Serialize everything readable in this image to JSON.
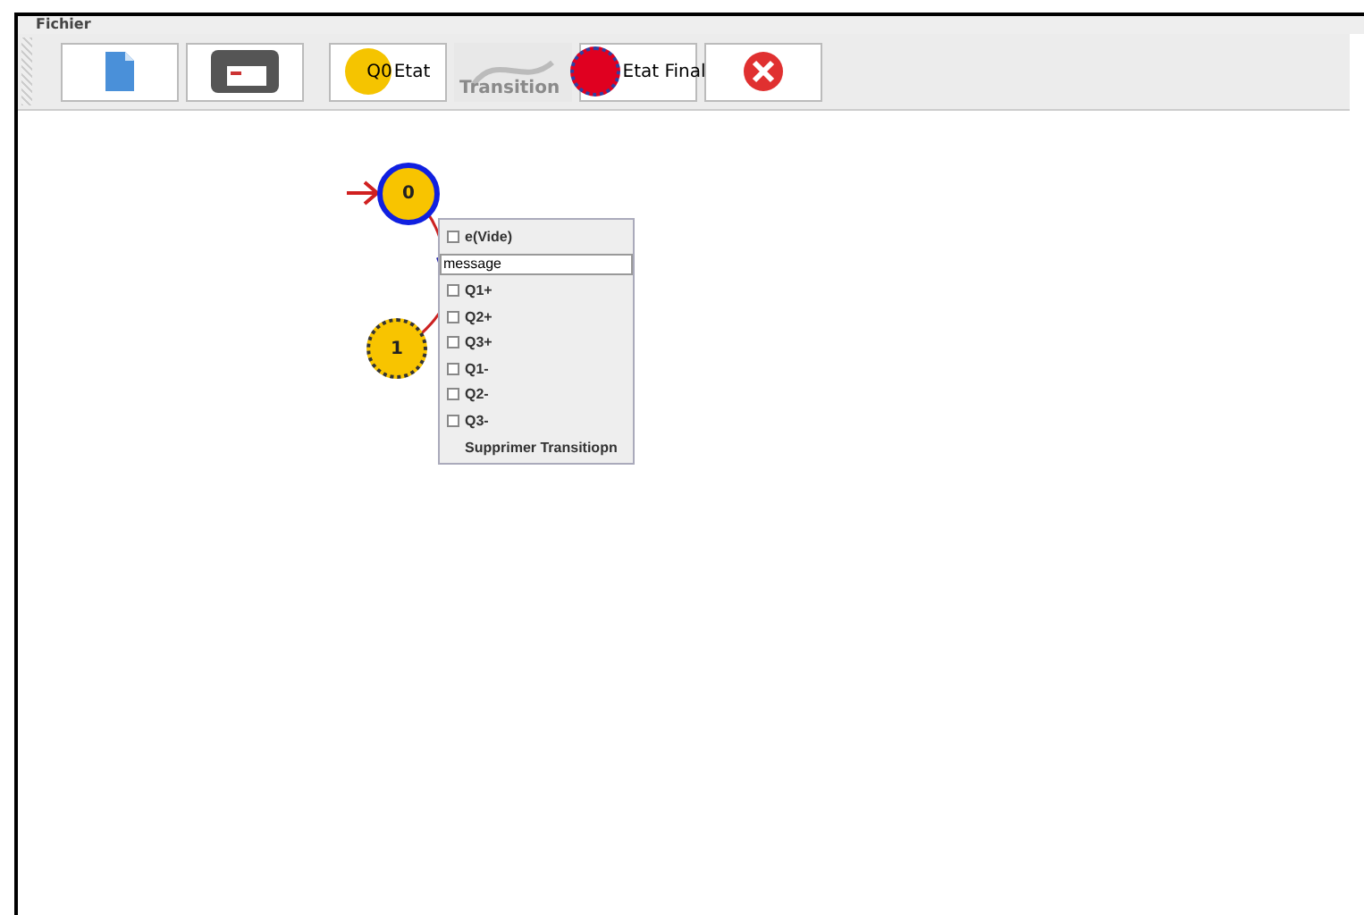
{
  "menu_bar": {
    "items": [
      "Fichier"
    ]
  },
  "toolbar": {
    "buttons": [
      {
        "kind": "new",
        "disabled": false
      },
      {
        "kind": "save",
        "disabled": false
      },
      {
        "kind": "state",
        "disabled": false,
        "badge": "Q0",
        "label": "Etat"
      },
      {
        "kind": "transition",
        "disabled": true,
        "label": "Transition"
      },
      {
        "kind": "final",
        "disabled": false,
        "label": "Etat Final"
      },
      {
        "kind": "delete",
        "disabled": false
      }
    ]
  },
  "diagram": {
    "states": [
      {
        "label": "0",
        "initial": true,
        "selected": true
      },
      {
        "label": "1",
        "initial": false,
        "selected": false
      }
    ]
  },
  "context_menu": {
    "items": [
      {
        "kind": "checkbox",
        "label": "e(Vide)",
        "checked": false
      },
      {
        "kind": "field",
        "value": "message"
      },
      {
        "kind": "checkbox",
        "label": "Q1+",
        "checked": false
      },
      {
        "kind": "checkbox",
        "label": "Q2+",
        "checked": false
      },
      {
        "kind": "checkbox",
        "label": "Q3+",
        "checked": false
      },
      {
        "kind": "checkbox",
        "label": "Q1-",
        "checked": false
      },
      {
        "kind": "checkbox",
        "label": "Q2-",
        "checked": false
      },
      {
        "kind": "checkbox",
        "label": "Q3-",
        "checked": false
      },
      {
        "kind": "action",
        "label": "Supprimer Transitiopn"
      }
    ]
  }
}
